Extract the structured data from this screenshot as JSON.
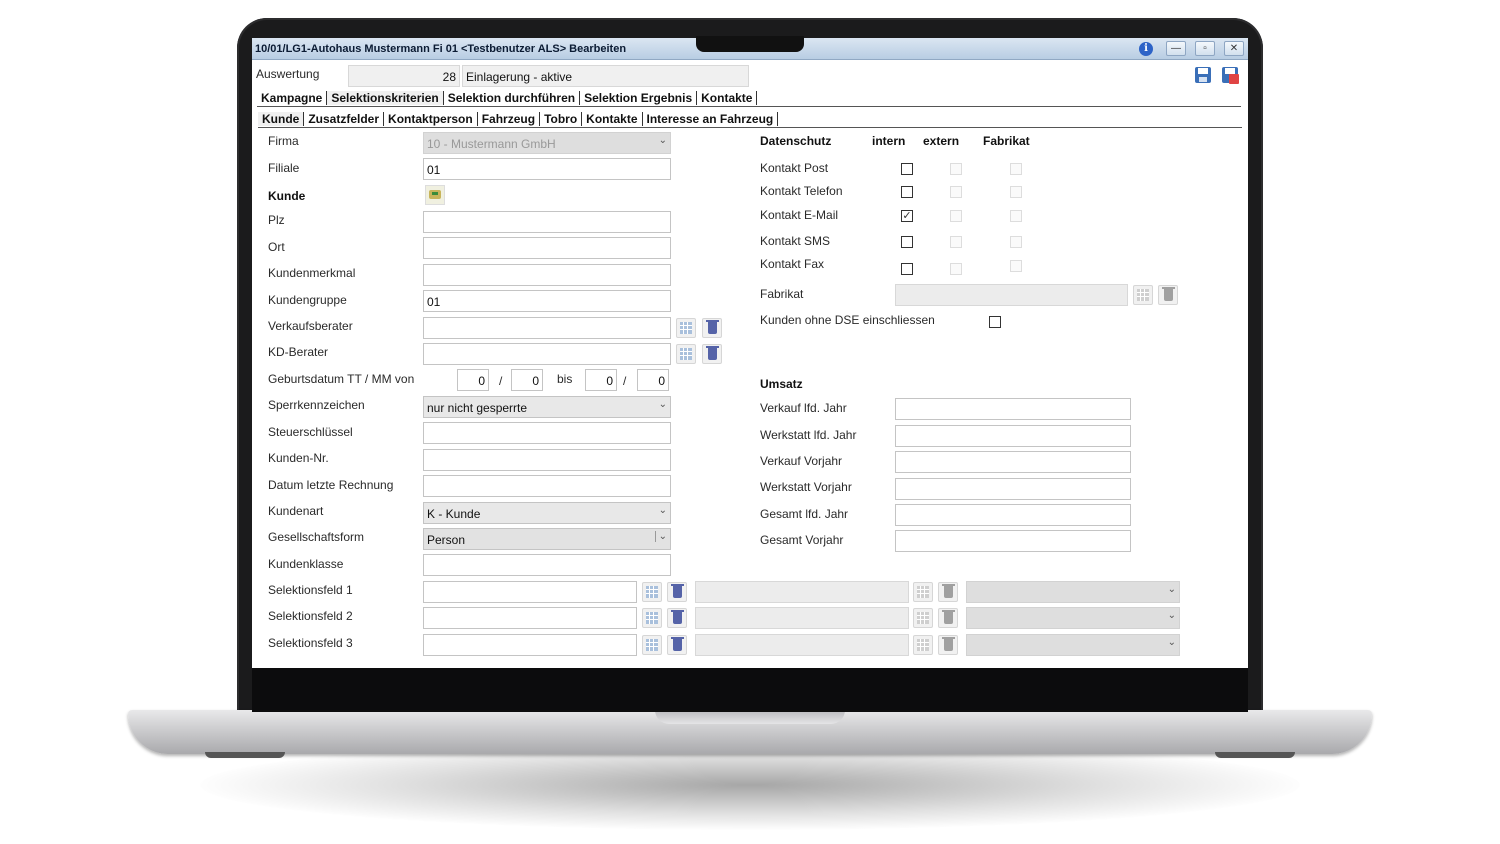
{
  "window": {
    "title": "10/01/LG1-Autohaus Mustermann Fi 01 <Testbenutzer ALS> Bearbeiten",
    "info_icon": "info-icon",
    "minimize_glyph": "—",
    "maximize_glyph": "▫",
    "close_glyph": "✕"
  },
  "auswertung": {
    "label": "Auswertung",
    "number": "28",
    "name": "Einlagerung - aktive"
  },
  "main_tabs": [
    "Kampagne",
    "Selektionskriterien",
    "Selektion durchführen",
    "Selektion Ergebnis",
    "Kontakte"
  ],
  "sub_tabs": [
    "Kunde",
    "Zusatzfelder",
    "Kontaktperson",
    "Fahrzeug",
    "Tobro",
    "Kontakte",
    "Interesse an Fahrzeug"
  ],
  "left_form": {
    "firma": {
      "label": "Firma",
      "value": "10 - Mustermann GmbH"
    },
    "filiale": {
      "label": "Filiale",
      "value": "01"
    },
    "kunde_header": "Kunde",
    "plz": {
      "label": "Plz",
      "value": ""
    },
    "ort": {
      "label": "Ort",
      "value": ""
    },
    "kundenmerkmal": {
      "label": "Kundenmerkmal",
      "value": ""
    },
    "kundengruppe": {
      "label": "Kundengruppe",
      "value": "01"
    },
    "verkaufsberater": {
      "label": "Verkaufsberater",
      "value": ""
    },
    "kd_berater": {
      "label": "KD-Berater",
      "value": ""
    },
    "geburtsdatum": {
      "label": "Geburtsdatum TT / MM  von",
      "von_tt": "0",
      "von_mm": "0",
      "bis_label": "bis",
      "bis_tt": "0",
      "bis_mm": "0",
      "sep": "/"
    },
    "sperrkennzeichen": {
      "label": "Sperrkennzeichen",
      "value": "nur nicht gesperrte"
    },
    "steuerschluessel": {
      "label": "Steuerschlüssel",
      "value": ""
    },
    "kunden_nr": {
      "label": "Kunden-Nr.",
      "value": ""
    },
    "datum_letzte_rechnung": {
      "label": "Datum letzte Rechnung",
      "value": ""
    },
    "kundenart": {
      "label": "Kundenart",
      "value": "K - Kunde"
    },
    "gesellschaftsform": {
      "label": "Gesellschaftsform",
      "value": "Person"
    },
    "kundenklasse": {
      "label": "Kundenklasse",
      "value": ""
    },
    "selektionsfeld_1": {
      "label": "Selektionsfeld 1",
      "value": ""
    },
    "selektionsfeld_2": {
      "label": "Selektionsfeld 2",
      "value": ""
    },
    "selektionsfeld_3": {
      "label": "Selektionsfeld 3",
      "value": ""
    }
  },
  "datenschutz": {
    "header": "Datenschutz",
    "col_intern": "intern",
    "col_extern": "extern",
    "col_fabrikat": "Fabrikat",
    "rows": [
      {
        "label": "Kontakt Post",
        "intern": false
      },
      {
        "label": "Kontakt Telefon",
        "intern": false
      },
      {
        "label": "Kontakt E-Mail",
        "intern": true
      },
      {
        "label": "Kontakt SMS",
        "intern": false
      },
      {
        "label": "Kontakt Fax",
        "intern": false
      }
    ],
    "fabrikat_label": "Fabrikat",
    "ohne_dse_label": "Kunden ohne DSE einschliessen",
    "ohne_dse_checked": false,
    "check_glyph": "✓"
  },
  "umsatz": {
    "header": "Umsatz",
    "fields": [
      {
        "label": "Verkauf lfd. Jahr",
        "value": ""
      },
      {
        "label": "Werkstatt lfd. Jahr",
        "value": ""
      },
      {
        "label": "Verkauf Vorjahr",
        "value": ""
      },
      {
        "label": "Werkstatt Vorjahr",
        "value": ""
      },
      {
        "label": "Gesamt lfd. Jahr",
        "value": ""
      },
      {
        "label": "Gesamt Vorjahr",
        "value": ""
      }
    ]
  },
  "icons": {
    "picker": "grid-list-icon",
    "delete": "trash-icon",
    "customer_search": "customer-search-icon",
    "save": "save-icon",
    "save_calendar": "save-calendar-icon"
  },
  "colors": {
    "titlebar_start": "#dbe6f2",
    "titlebar_end": "#b8cde3",
    "trash_blue": "#5563a8",
    "picker_blue": "#a9c0dc"
  }
}
